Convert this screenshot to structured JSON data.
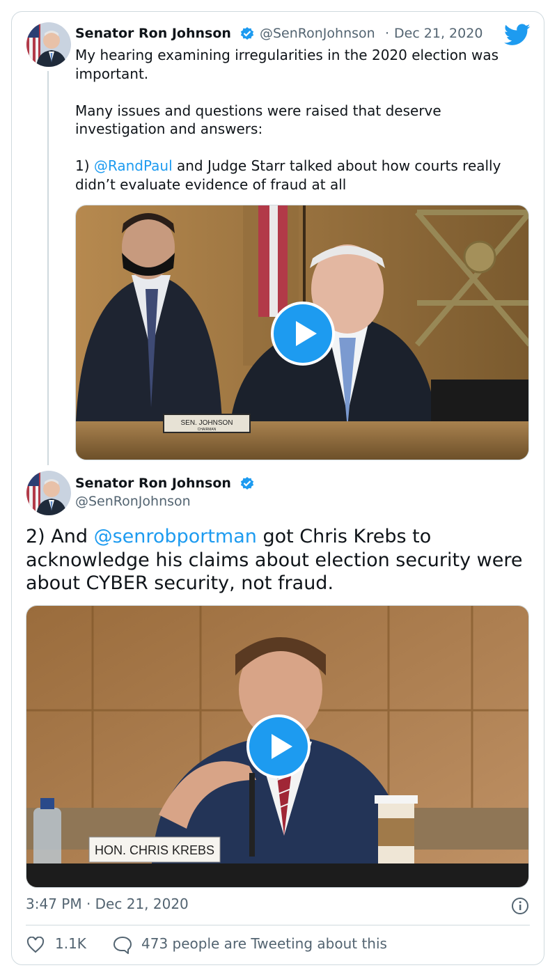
{
  "tweet1": {
    "author_name": "Senator Ron Johnson",
    "author_handle": "@SenRonJohnson",
    "separator": "·",
    "date": "Dec 21, 2020",
    "text_line_a": "My hearing examining irregularities in the 2020 election was important.",
    "text_line_b": "Many issues and questions were raised that deserve investigation and answers:",
    "text_prefix": "1) ",
    "mention": "@RandPaul",
    "text_suffix": " and Judge Starr talked about how courts really didn’t evaluate evidence of fraud at all",
    "video_nameplate": "SEN. JOHNSON",
    "video_nameplate_sub": "CHAIRMAN"
  },
  "tweet2": {
    "author_name": "Senator Ron Johnson",
    "author_handle": "@SenRonJohnson",
    "text_prefix": "2) And ",
    "mention": "@senrobportman",
    "text_suffix": " got Chris Krebs to acknowledge his claims about election security were about CYBER security, not fraud.",
    "video_nameplate": "HON. CHRIS KREBS"
  },
  "footer": {
    "timestamp": "3:47 PM · Dec 21, 2020",
    "likes": "1.1K",
    "replies_text": "473 people are Tweeting about this"
  },
  "icons": {
    "verified": "verified-badge-icon",
    "twitter": "twitter-bird-icon",
    "info": "info-icon",
    "like": "heart-icon",
    "reply": "speech-bubble-icon",
    "play": "play-icon"
  },
  "colors": {
    "link": "#1d9bf0",
    "secondary_text": "#536471",
    "border": "#cfd9de"
  }
}
